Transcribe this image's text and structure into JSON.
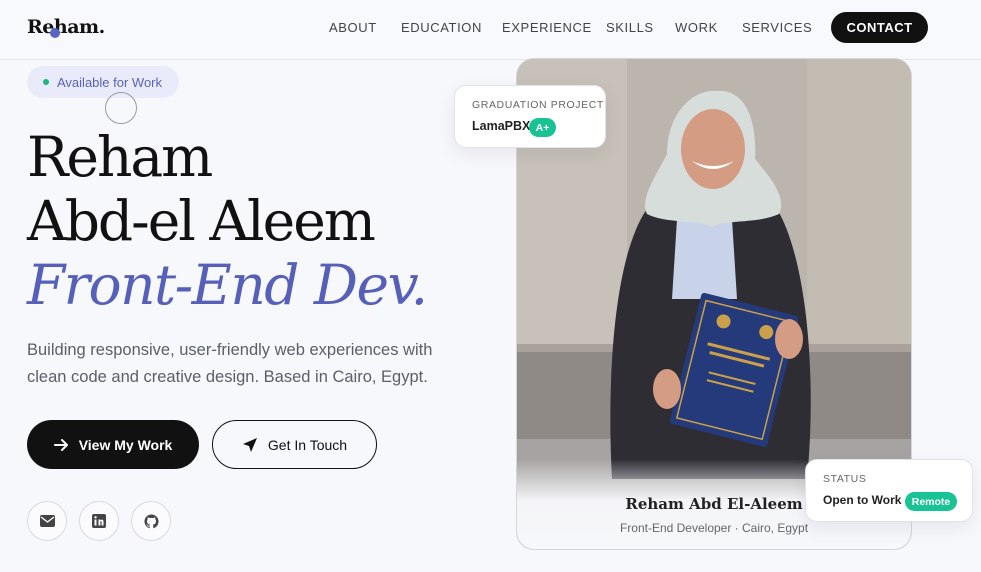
{
  "header": {
    "logo": "Reham.",
    "nav": [
      "ABOUT",
      "EDUCATION",
      "EXPERIENCE",
      "SKILLS",
      "WORK",
      "SERVICES"
    ],
    "contact": "CONTACT"
  },
  "hero": {
    "availability": "Available for Work",
    "name_line1": "Reham",
    "name_line2": "Abd-el Aleem",
    "role": "Front-End Dev.",
    "intro": "Building responsive, user-friendly web experiences with clean code and creative design. Based in Cairo, Egypt.",
    "primary_button": "View My Work",
    "secondary_button": "Get In Touch",
    "social": [
      "mail-icon",
      "linkedin-icon",
      "github-icon"
    ]
  },
  "photo_card": {
    "name": "Reham Abd El-Aleem",
    "role": "Front-End Developer · Cairo, Egypt"
  },
  "graduation_card": {
    "label": "GRADUATION PROJECT",
    "project": "LamaPBX",
    "grade": "A+"
  },
  "status_card": {
    "label": "STATUS",
    "value": "Open to Work",
    "badge": "Remote"
  },
  "colors": {
    "accent": "#5660b9",
    "dark": "#111111",
    "green": "#19c393"
  }
}
